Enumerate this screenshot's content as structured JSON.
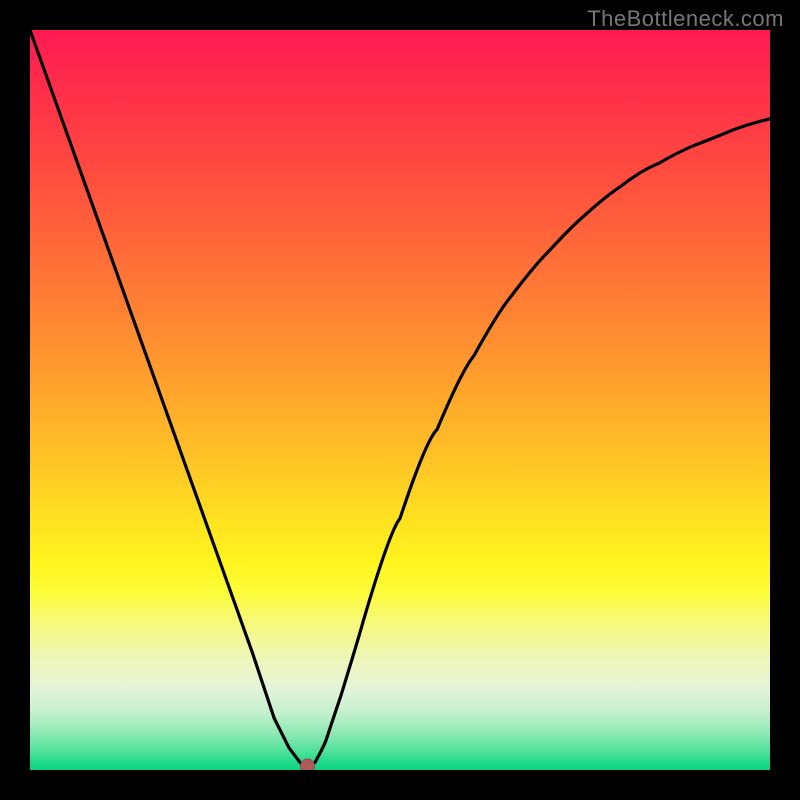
{
  "watermark": "TheBottleneck.com",
  "chart_data": {
    "type": "line",
    "title": "",
    "xlabel": "",
    "ylabel": "",
    "xlim": [
      0,
      100
    ],
    "ylim": [
      0,
      100
    ],
    "grid": false,
    "series": [
      {
        "name": "bottleneck-curve",
        "x": [
          0,
          5,
          10,
          15,
          20,
          25,
          30,
          33,
          35,
          36.5,
          37.5,
          38.5,
          40,
          42,
          45,
          50,
          55,
          60,
          65,
          70,
          75,
          80,
          85,
          90,
          95,
          100
        ],
        "values": [
          100,
          86,
          72,
          58,
          44,
          30,
          16,
          7,
          3,
          1,
          0,
          1,
          4,
          10,
          20,
          34,
          46,
          56,
          64,
          70,
          75,
          79,
          82,
          84.5,
          86.5,
          88
        ]
      }
    ],
    "marker": {
      "x": 37.5,
      "y": 0,
      "name": "minimum-dot"
    },
    "background_gradient": {
      "top": "#ff1a53",
      "mid_orange": "#ff8233",
      "mid_yellow": "#ffe120",
      "pale": "#eef6b8",
      "bottom": "#0ed183"
    }
  }
}
